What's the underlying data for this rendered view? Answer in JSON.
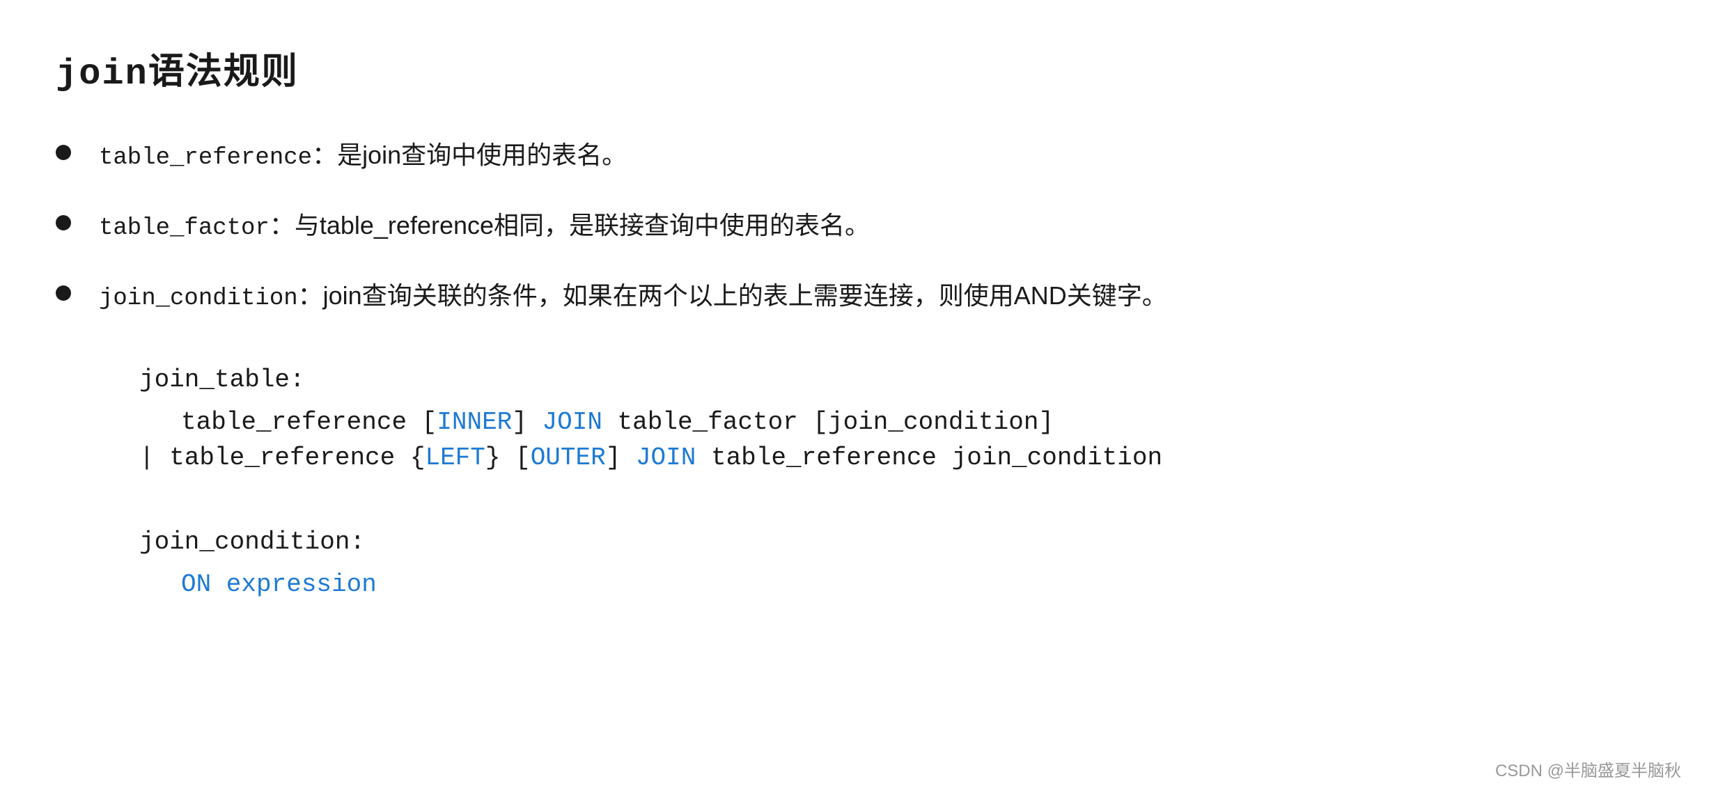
{
  "title": {
    "code_part": "join",
    "text_part": "语法规则"
  },
  "bullets": [
    {
      "id": "bullet1",
      "code": "table_reference",
      "text": "：是join查询中使用的表名。"
    },
    {
      "id": "bullet2",
      "code": "table_factor",
      "text": "：与table_reference相同，是联接查询中使用的表名。"
    },
    {
      "id": "bullet3",
      "code": "join_condition",
      "text": "：join查询关联的条件，如果在两个以上的表上需要连接，则使用AND关键字。"
    }
  ],
  "grammar_blocks": [
    {
      "label": "join_table:",
      "lines": [
        {
          "indent": true,
          "parts": [
            {
              "text": "table_reference [",
              "blue": false
            },
            {
              "text": "INNER",
              "blue": true
            },
            {
              "text": "] ",
              "blue": false
            },
            {
              "text": "JOIN",
              "blue": true
            },
            {
              "text": " table_factor [join_condition]",
              "blue": false
            }
          ]
        },
        {
          "indent": false,
          "parts": [
            {
              "text": "| table_reference {",
              "blue": false
            },
            {
              "text": "LEFT",
              "blue": true
            },
            {
              "text": "} [",
              "blue": false
            },
            {
              "text": "OUTER",
              "blue": true
            },
            {
              "text": "] ",
              "blue": false
            },
            {
              "text": "JOIN",
              "blue": true
            },
            {
              "text": " table_reference join_condition",
              "blue": false
            }
          ]
        }
      ]
    },
    {
      "label": "join_condition:",
      "lines": [
        {
          "indent": true,
          "parts": [
            {
              "text": "ON expression",
              "blue": true
            }
          ]
        }
      ]
    }
  ],
  "watermark": "CSDN @半脑盛夏半脑秋"
}
